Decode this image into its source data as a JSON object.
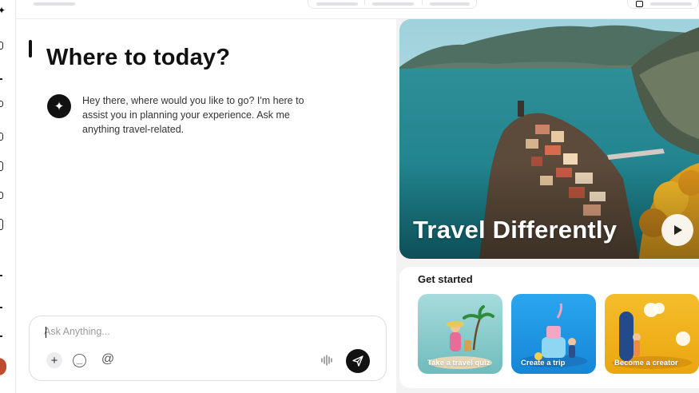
{
  "main": {
    "title": "Where to today?",
    "assistant_message": "Hey there, where would you like to go? I'm here to assist you in planning your experience. Ask me anything travel-related."
  },
  "composer": {
    "placeholder": "Ask Anything...",
    "icons": [
      "plus-icon",
      "emoji-icon",
      "at-icon",
      "voice-icon",
      "send-icon"
    ]
  },
  "hero": {
    "title": "Travel Differently"
  },
  "get_started": {
    "title": "Get started",
    "cards": [
      {
        "label": "Take a travel quiz",
        "color": "#8fd0cf"
      },
      {
        "label": "Create a trip",
        "color": "#1f9be6"
      },
      {
        "label": "Become a creator",
        "color": "#f0b21b"
      }
    ]
  },
  "colors": {
    "accent": "#111111",
    "background": "#f3f3f4"
  }
}
